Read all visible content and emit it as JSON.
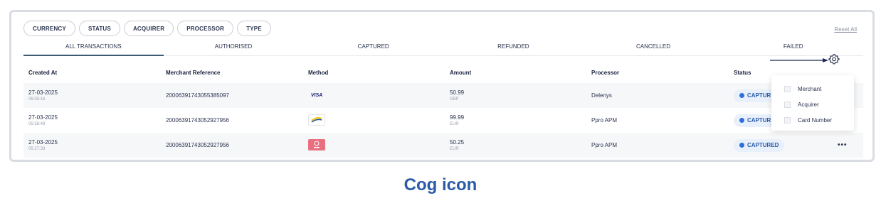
{
  "filters": [
    "CURRENCY",
    "STATUS",
    "ACQUIRER",
    "PROCESSOR",
    "TYPE"
  ],
  "reset_label": "Reset All",
  "tabs": [
    "ALL TRANSACTIONS",
    "AUTHORISED",
    "CAPTURED",
    "REFUNDED",
    "CANCELLED",
    "FAILED"
  ],
  "active_tab": "ALL TRANSACTIONS",
  "columns": [
    "Created At",
    "Merchant Reference",
    "Method",
    "Amount",
    "Processor",
    "Status"
  ],
  "rows": [
    {
      "date": "27-03-2025",
      "time": "06:05:16",
      "reference": "20006391743055385097",
      "method": "visa",
      "method_text": "VISA",
      "amount": "50.99",
      "currency": "GBP",
      "processor": "Delenys",
      "status": "CAPTUR"
    },
    {
      "date": "27-03-2025",
      "time": "05:58:49",
      "reference": "20006391743052927956",
      "method": "yellow-card-icon",
      "amount": "99.99",
      "currency": "EUR",
      "processor": "Ppro APM",
      "status": "CAPTUR"
    },
    {
      "date": "27-03-2025",
      "time": "05:27:33",
      "reference": "20006391743052927956",
      "method": "pink-wallet-icon",
      "amount": "50.25",
      "currency": "EUR",
      "processor": "Ppro APM",
      "status": "CAPTURED"
    }
  ],
  "dropdown_options": [
    "Merchant",
    "Acquirer",
    "Card Number"
  ],
  "more_label": "•••",
  "caption": "Cog icon",
  "colors": {
    "accent": "#2a5ba8",
    "status_dot": "#2f6fd8",
    "status_bg": "#e8f0fb"
  }
}
